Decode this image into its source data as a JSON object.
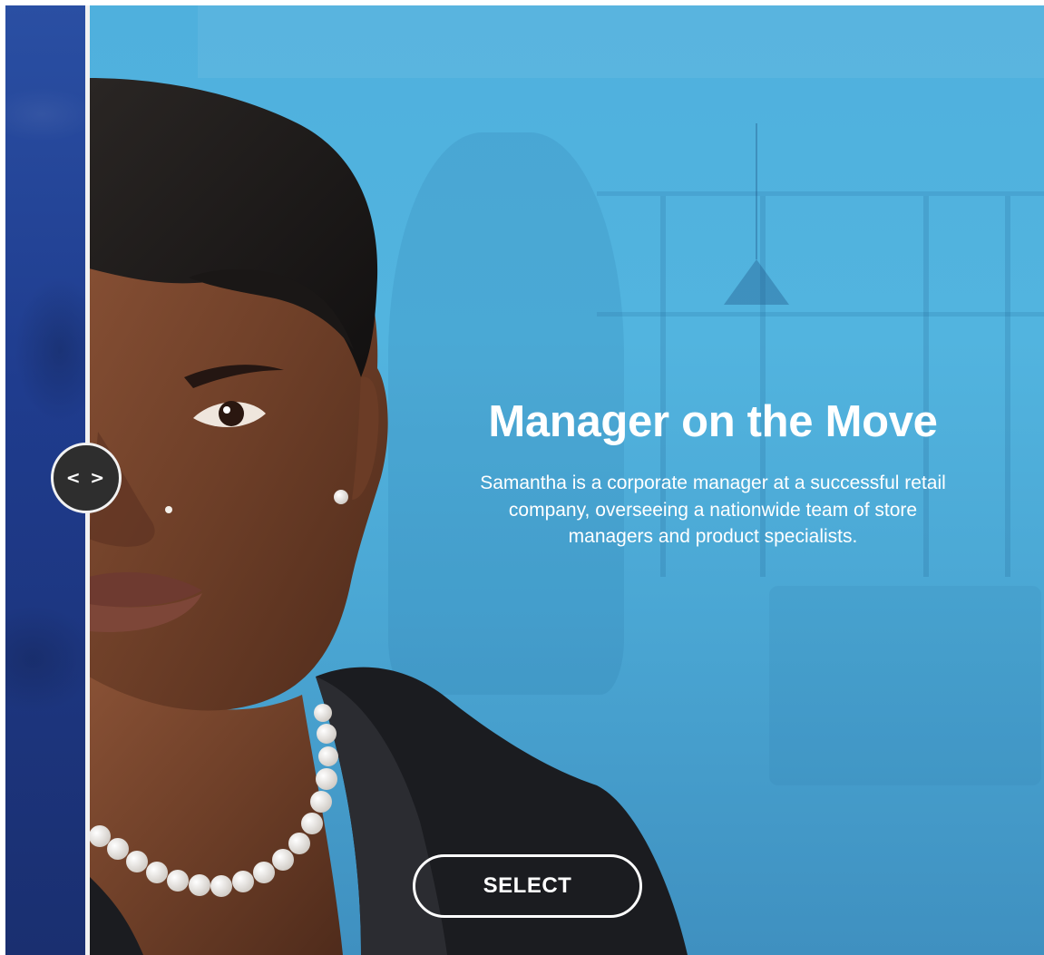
{
  "slider": {
    "handle_label": "< >"
  },
  "card": {
    "title": "Manager on the Move",
    "description": "Samantha is a corporate manager at a successful retail company, overseeing a nationwide team of store managers and product specialists.",
    "select_label": "SELECT"
  },
  "colors": {
    "left_panel": "#1f3c8e",
    "main_panel": "#4fb0dd",
    "handle": "#2e2e2e",
    "text": "#ffffff"
  },
  "icons": {
    "handle": "left-right-arrows-icon"
  }
}
